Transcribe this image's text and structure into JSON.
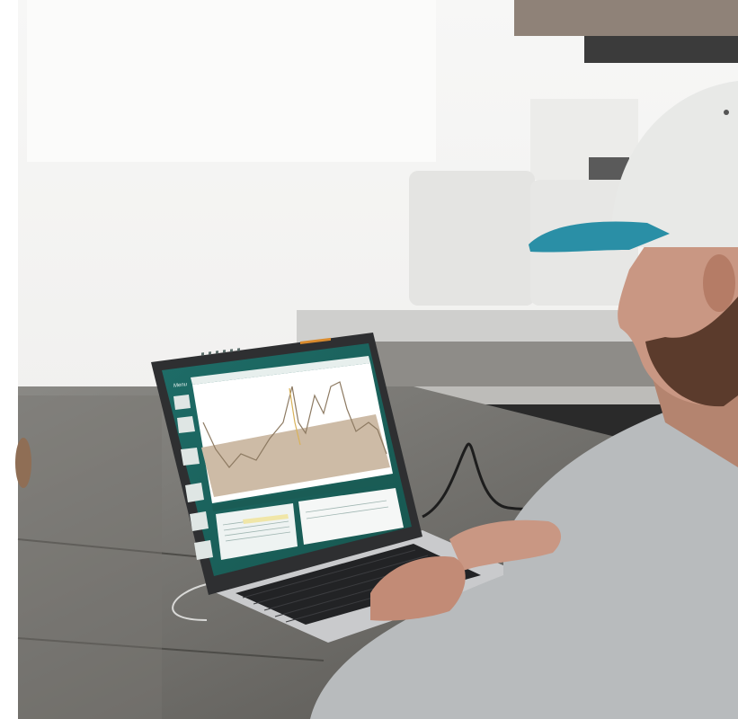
{
  "scene": {
    "description_tags": [
      "photo",
      "laptop",
      "person-typing"
    ],
    "colors": {
      "wall": "#f1f1f0",
      "sofa": "#8c8a86",
      "table": "#6d6c68",
      "cap_white": "#e8e9e7",
      "cap_brim": "#2a8fa6",
      "skin": "#c99783",
      "shirt": "#b8bbbd",
      "laptop_body": "#2e2f31",
      "app_teal": "#1f6f66",
      "chart_band": "#cdbba6",
      "chart_line": "#8d7a62"
    }
  },
  "laptop_app": {
    "menu_label": "Menu",
    "window_title": "",
    "toolbar_icons": [
      "zoom-icon",
      "pan-icon",
      "cursor-icon",
      "marker-icon",
      "grid-icon",
      "export-icon"
    ]
  }
}
